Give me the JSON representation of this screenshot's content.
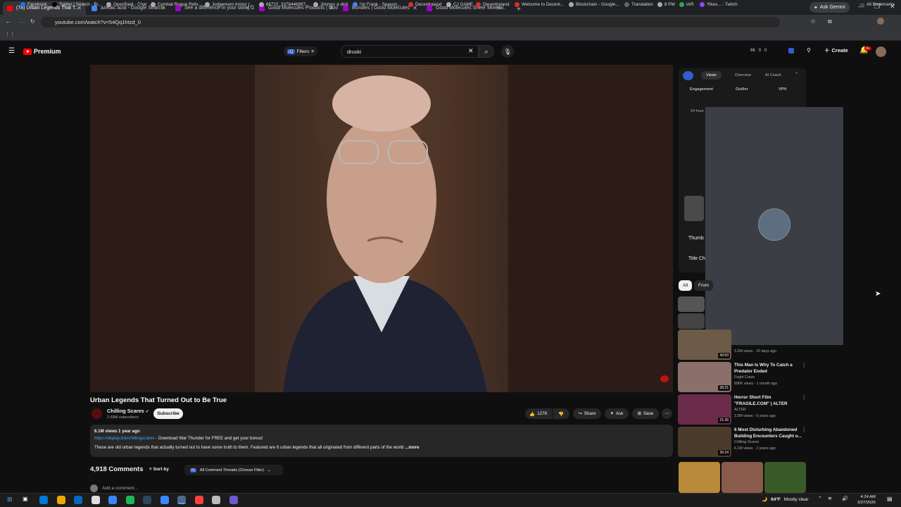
{
  "browser": {
    "tabs": [
      {
        "label": "(78) Urban Legends That T...",
        "active": true,
        "color": "#ff0000"
      },
      {
        "label": "azelaic acid - Google Search",
        "active": false,
        "color": "#4285f4"
      },
      {
        "label": "See a difference in your skin | G...",
        "active": false,
        "color": "#a000c8"
      },
      {
        "label": "Good Molecules Products | Goo...",
        "active": false,
        "color": "#a000c8"
      },
      {
        "label": "Bundles | Good Molecules",
        "active": false,
        "color": "#a000c8"
      },
      {
        "label": "Good Molecules Sheer Mineral...",
        "active": false,
        "color": "#a000c8"
      }
    ],
    "new_tab": "+",
    "ask_gemini": "Ask Gemini",
    "url": "youtube.com/watch?v=54Qq1htzd_0",
    "bookmarks": [
      "Facebook",
      "Twitter / Search - Bi...",
      "OpenRaid - Chat",
      "Combat Rogue Refo...",
      "Judgement Armor (...",
      "66722_3376446997...",
      "Jimmys a dick",
      "I'm Frank - Season...",
      "Decentraland",
      "CJ GAME",
      "Decentraland",
      "Welcome to Decent...",
      "Blockchain - Google...",
      "Translation",
      "8 PM",
      "IAR",
      "Yikes... - Twitch"
    ],
    "all_bookmarks": "All Bookmarks"
  },
  "youtube": {
    "logo_text": "Premium",
    "filters_label": "Filters",
    "search_value": "druski",
    "header_counts": [
      "66",
      "0",
      "0"
    ],
    "create_label": "Create",
    "notif_count": "9+"
  },
  "video": {
    "title": "Urban Legends That Turned Out to Be True",
    "channel": "Chilling Scares",
    "subscribers": "2.69M subscribers",
    "subscribe_label": "Subscribe",
    "likes": "127K",
    "share_label": "Share",
    "ask_label": "Ask",
    "save_label": "Save",
    "views_meta": "6.1M views  1 year ago",
    "desc_link": "https://wtpla.y.link/chillingscares",
    "desc_link_text": "https://wtplay.link/chillingscares",
    "desc_promo": " - Download War Thunder for FREE and get your bonus!",
    "desc_text": "These are old urban legends that actually turned out to have some truth to them. Featured are 6 urban legends that all originated from different parts of the world",
    "desc_more": "...more"
  },
  "comments": {
    "count": "4,918 Comments",
    "sort_label": "Sort by",
    "thread_filter": "All Comment Threads (Choose Filter)",
    "add_placeholder": "Add a comment..."
  },
  "extension": {
    "tabs": [
      "Views",
      "Overview",
      "AI Coach"
    ],
    "metrics": [
      "Engagement",
      "Outlier",
      "VPH"
    ],
    "range_label": "24 hour",
    "row_thumb": "Thumb",
    "row_title": "Title Ch"
  },
  "chips": [
    "All",
    "From"
  ],
  "recommendations": [
    {
      "title": "",
      "channel": "",
      "stats": "3.2M views · 10 days ago",
      "duration": "43:50",
      "color": "#6b5b48"
    },
    {
      "title": "This Man Is Why To Catch a Predator Ended",
      "channel": "Fright Crave",
      "stats": "896K views · 1 month ago",
      "duration": "36:21",
      "color": "#8a6f6a"
    },
    {
      "title": "Horror Short Film \"FRAGILE.COM\" | ALTER",
      "channel": "ALTER",
      "stats": "3.3M views · 5 years ago",
      "duration": "21:36",
      "color": "#6a2c4a"
    },
    {
      "title": "6 Most Disturbing Abandoned Building Encounters Caught o...",
      "channel": "Chilling Scares",
      "stats": "6.1M views · 2 years ago",
      "duration": "26:24",
      "color": "#4a3b2b"
    }
  ],
  "taskbar": {
    "weather": "64°F",
    "weather_desc": "Mostly clear",
    "time": "4:24 AM",
    "date": "3/27/2026"
  }
}
